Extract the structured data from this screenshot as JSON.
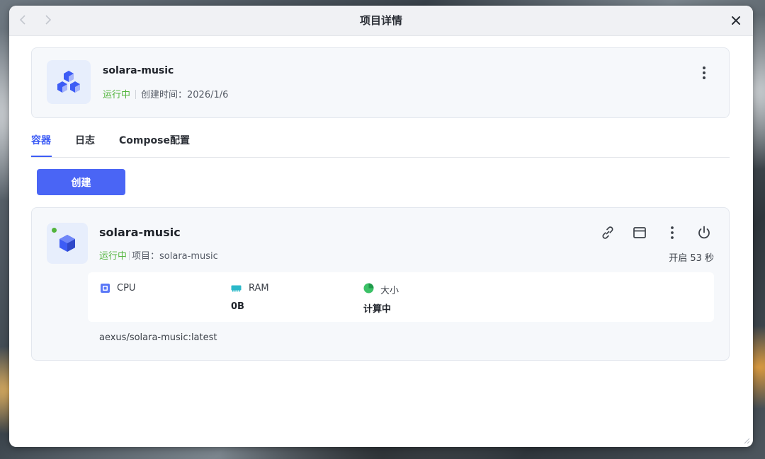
{
  "window": {
    "title": "项目详情"
  },
  "project": {
    "name": "solara-music",
    "status": "运行中",
    "created": "创建时间：2026/1/6"
  },
  "tabs": [
    "容器",
    "日志",
    "Compose配置"
  ],
  "actions": {
    "create_label": "创建"
  },
  "container": {
    "name": "solara-music",
    "status": "运行中",
    "project_label": "项目：solara-music",
    "uptime": "开启 53 秒",
    "stats": {
      "cpu_label": "CPU",
      "ram_label": "RAM",
      "ram_value": "0B",
      "size_label": "大小",
      "size_value": "计算中"
    },
    "image": "aexus/solara-music:latest"
  },
  "colors": {
    "accent": "#4a65f5",
    "running": "#52b43d",
    "card_bg": "#f6f8fb"
  },
  "icons": [
    "chevron-left-icon",
    "chevron-right-icon",
    "close-icon",
    "cubes-icon",
    "more-vertical-icon",
    "cube-icon",
    "link-icon",
    "window-icon",
    "power-icon",
    "cpu-icon",
    "ram-icon",
    "pie-chart-icon"
  ]
}
